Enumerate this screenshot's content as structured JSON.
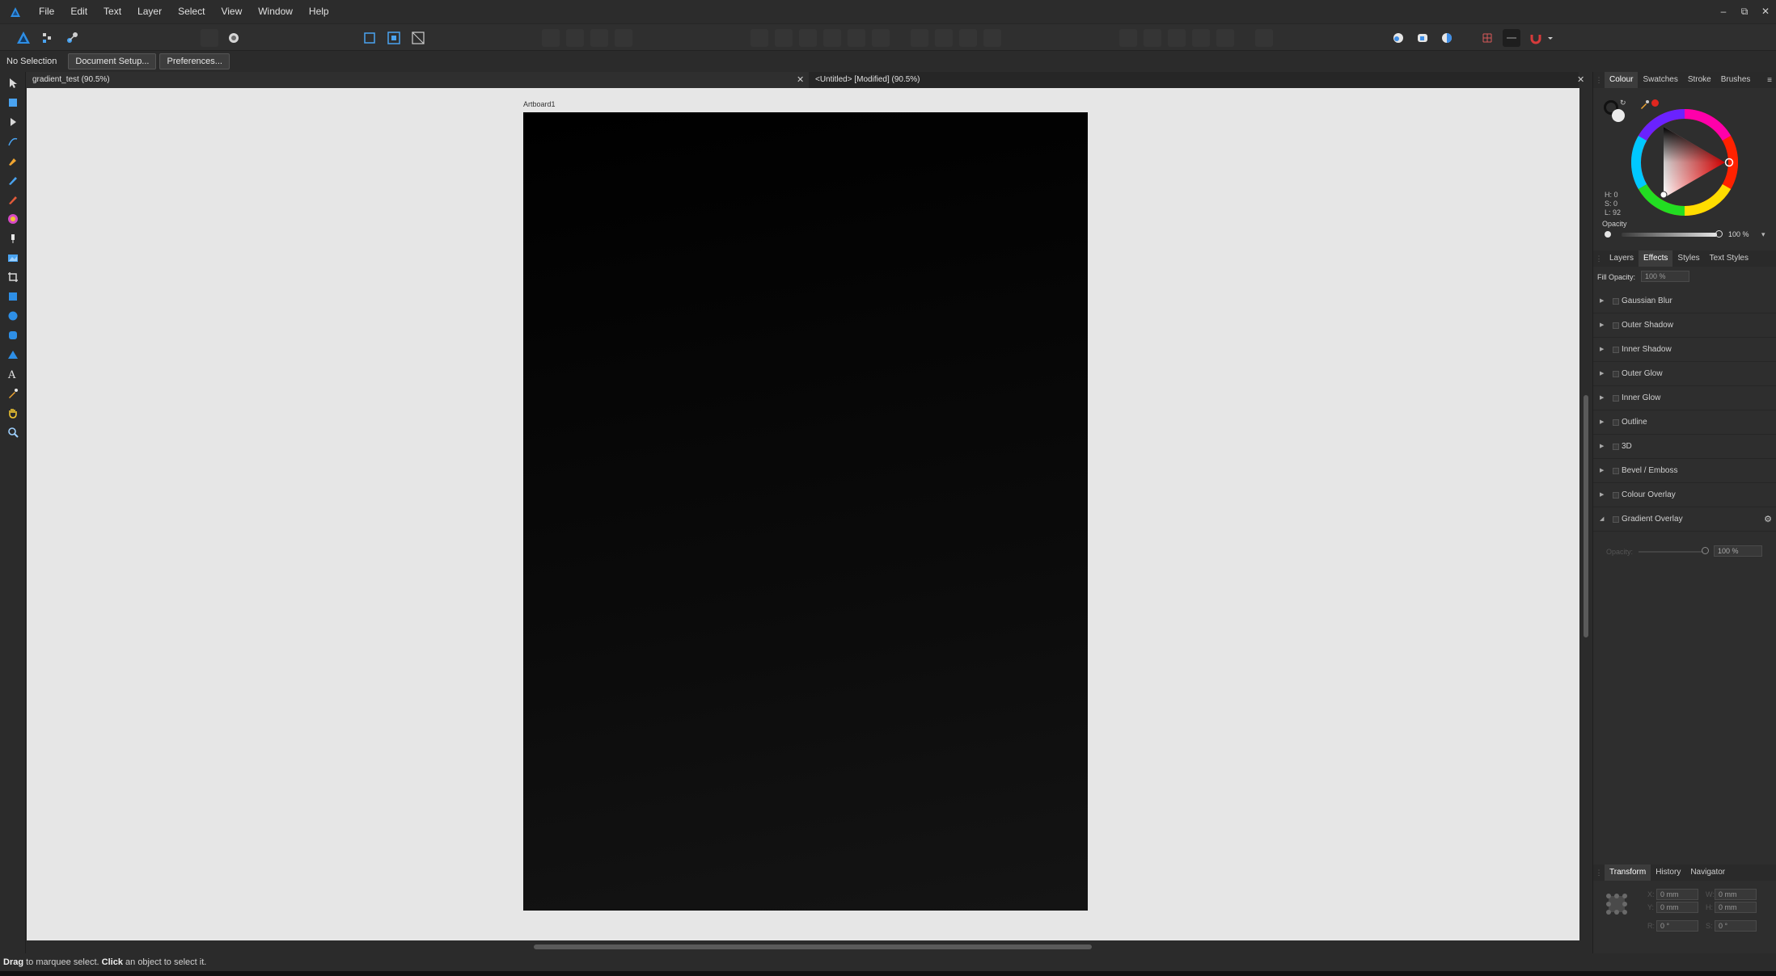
{
  "menubar": {
    "items": [
      "File",
      "Edit",
      "Text",
      "Layer",
      "Select",
      "View",
      "Window",
      "Help"
    ]
  },
  "window_controls": {
    "minimize": "–",
    "restore": "⧉",
    "close": "✕"
  },
  "contextbar": {
    "selection_label": "No Selection",
    "document_setup_label": "Document Setup...",
    "preferences_label": "Preferences..."
  },
  "tabs": [
    {
      "label": "gradient_test (90.5%)"
    },
    {
      "label": "<Untitled> [Modified] (90.5%)"
    }
  ],
  "canvas": {
    "artboard_label": "Artboard1"
  },
  "colour_panel": {
    "tabs": [
      "Colour",
      "Swatches",
      "Stroke",
      "Brushes"
    ],
    "h": "H: 0",
    "s": "S: 0",
    "l": "L: 92",
    "opacity_label": "Opacity",
    "opacity_value": "100 %",
    "opacity_level": 1.0,
    "accent": "#e0271f"
  },
  "effects_panel": {
    "tabs": [
      "Layers",
      "Effects",
      "Styles",
      "Text Styles"
    ],
    "fill_opacity_label": "Fill Opacity:",
    "fill_opacity_value": "100 %",
    "effects": [
      "Gaussian Blur",
      "Outer Shadow",
      "Inner Shadow",
      "Outer Glow",
      "Inner Glow",
      "Outline",
      "3D",
      "Bevel / Emboss",
      "Colour Overlay",
      "Gradient Overlay"
    ],
    "gradient_opacity_label": "Opacity:",
    "gradient_opacity_value": "100 %"
  },
  "transform_panel": {
    "tabs": [
      "Transform",
      "History",
      "Navigator"
    ],
    "x_label": "X:",
    "x_value": "0 mm",
    "y_label": "Y:",
    "y_value": "0 mm",
    "w_label": "W:",
    "w_value": "0 mm",
    "h_label": "H:",
    "h_value": "0 mm",
    "r_label": "R:",
    "r_value": "0 °",
    "s_label": "S:",
    "s_value": "0 °"
  },
  "statusbar": {
    "drag_word": "Drag",
    "drag_text": " to marquee select. ",
    "click_word": "Click",
    "click_text": " an object to select it."
  }
}
